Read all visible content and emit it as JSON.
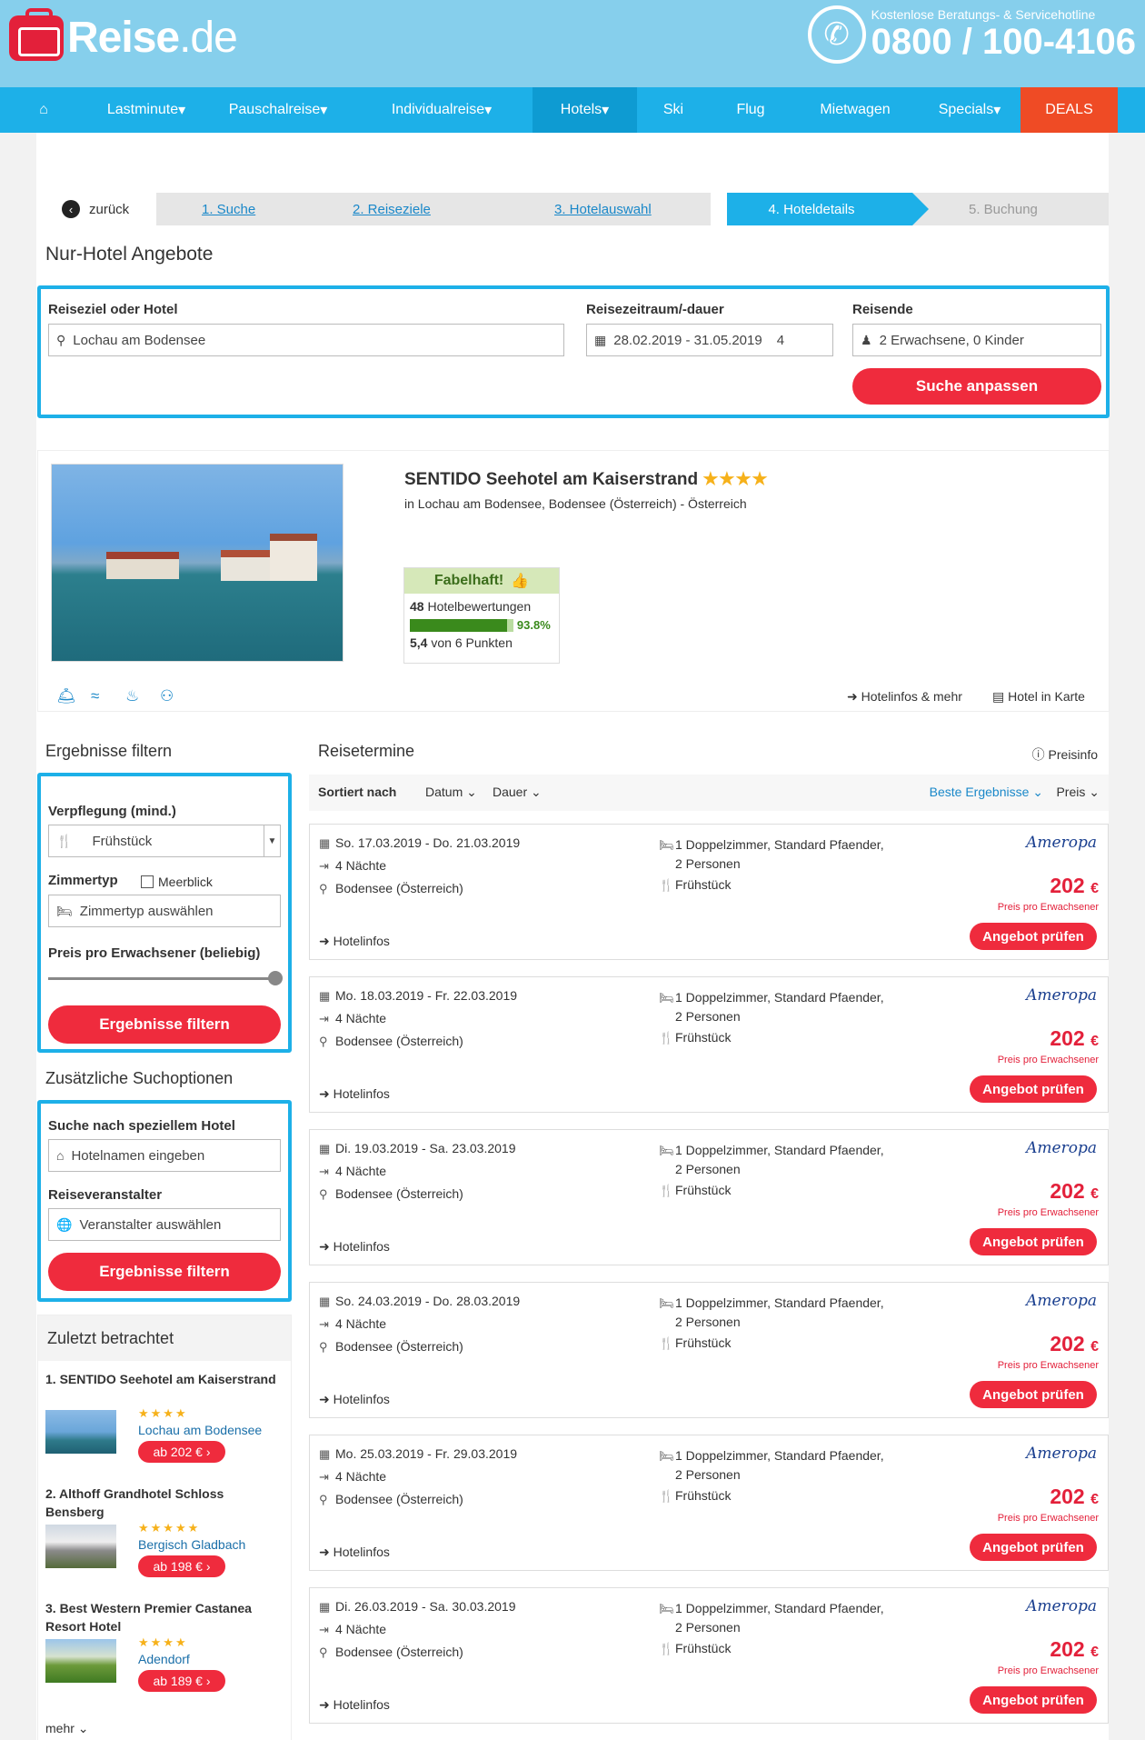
{
  "brand": {
    "logo_main": "Reise",
    "logo_suffix": ".de"
  },
  "hotline": {
    "label": "Kostenlose Beratungs- & Servicehotline",
    "number": "0800 / 100-4106"
  },
  "nav": {
    "home_icon": "home-icon",
    "items": [
      "Lastminute",
      "Pauschalreise",
      "Individualreise",
      "Hotels",
      "Ski",
      "Flug",
      "Mietwagen",
      "Specials",
      "DEALS"
    ],
    "active": "Hotels"
  },
  "steps": {
    "back": "zurück",
    "items": [
      "1. Suche",
      "2. Reiseziele",
      "3. Hotelauswahl",
      "4. Hoteldetails",
      "5. Buchung"
    ],
    "current": 3
  },
  "page_title": "Nur-Hotel Angebote",
  "search": {
    "destination_label": "Reiseziel oder Hotel",
    "destination_value": "Lochau am Bodensee",
    "period_label": "Reisezeitraum/-dauer",
    "period_value": "28.02.2019 - 31.05.2019",
    "duration_value": "4",
    "travelers_label": "Reisende",
    "travelers_value": "2 Erwachsene, 0 Kinder",
    "submit": "Suche anpassen"
  },
  "hotel": {
    "name": "SENTIDO Seehotel am Kaiserstrand",
    "stars": "★★★★",
    "location": "in Lochau am Bodensee, Bodensee (Österreich) - Österreich",
    "rating_label": "Fabelhaft!",
    "reviews_count": "48",
    "reviews_text": "Hotelbewertungen",
    "recommend_pct": "93.8%",
    "recommend_fraction": 0.938,
    "score": "5,4",
    "score_text": "von 6 Punkten",
    "link_info": "Hotelinfos & mehr",
    "link_map": "Hotel in Karte"
  },
  "filter": {
    "title": "Ergebnisse filtern",
    "board_label": "Verpflegung (mind.)",
    "board_value": "Frühstück",
    "room_label": "Zimmertyp",
    "seaview_label": "Meerblick",
    "room_placeholder": "Zimmertyp auswählen",
    "price_label": "Preis pro Erwachsener (beliebig)",
    "slider_value": 1.0,
    "submit": "Ergebnisse filtern"
  },
  "extra": {
    "title": "Zusätzliche Suchoptionen",
    "hotel_label": "Suche nach speziellem Hotel",
    "hotel_placeholder": "Hotelnamen eingeben",
    "operator_label": "Reiseveranstalter",
    "operator_placeholder": "Veranstalter auswählen",
    "submit": "Ergebnisse filtern"
  },
  "recent": {
    "title": "Zuletzt betrachtet",
    "items": [
      {
        "name": "1. SENTIDO Seehotel am Kaiserstrand",
        "stars": "★★★★",
        "city": "Lochau am Bodensee",
        "price": "ab 202 € ›"
      },
      {
        "name": "2. Althoff Grandhotel Schloss Bensberg",
        "stars": "★★★★★",
        "city": "Bergisch Gladbach",
        "price": "ab 198 € ›"
      },
      {
        "name": "3. Best Western Premier Castanea Resort Hotel",
        "stars": "★★★★",
        "city": "Adendorf",
        "price": "ab 189 € ›"
      }
    ],
    "more": "mehr"
  },
  "results": {
    "title": "Reisetermine",
    "price_info": "Preisinfo",
    "sort_label": "Sortiert nach",
    "sort_date": "Datum",
    "sort_duration": "Dauer",
    "sort_best": "Beste Ergebnisse",
    "sort_price": "Preis",
    "items": [
      {
        "dates": "So. 17.03.2019 - Do. 21.03.2019",
        "nights": "4 Nächte",
        "region": "Bodensee (Österreich)",
        "room1": "1 Doppelzimmer, Standard Pfaender,",
        "room2": "2 Personen",
        "board": "Frühstück",
        "operator": "Ameropa",
        "price": "202",
        "currency": "€",
        "per": "Preis pro Erwachsener",
        "info": "Hotelinfos",
        "cta": "Angebot prüfen"
      },
      {
        "dates": "Mo. 18.03.2019 - Fr. 22.03.2019",
        "nights": "4 Nächte",
        "region": "Bodensee (Österreich)",
        "room1": "1 Doppelzimmer, Standard Pfaender,",
        "room2": "2 Personen",
        "board": "Frühstück",
        "operator": "Ameropa",
        "price": "202",
        "currency": "€",
        "per": "Preis pro Erwachsener",
        "info": "Hotelinfos",
        "cta": "Angebot prüfen"
      },
      {
        "dates": "Di. 19.03.2019 - Sa. 23.03.2019",
        "nights": "4 Nächte",
        "region": "Bodensee (Österreich)",
        "room1": "1 Doppelzimmer, Standard Pfaender,",
        "room2": "2 Personen",
        "board": "Frühstück",
        "operator": "Ameropa",
        "price": "202",
        "currency": "€",
        "per": "Preis pro Erwachsener",
        "info": "Hotelinfos",
        "cta": "Angebot prüfen"
      },
      {
        "dates": "So. 24.03.2019 - Do. 28.03.2019",
        "nights": "4 Nächte",
        "region": "Bodensee (Österreich)",
        "room1": "1 Doppelzimmer, Standard Pfaender,",
        "room2": "2 Personen",
        "board": "Frühstück",
        "operator": "Ameropa",
        "price": "202",
        "currency": "€",
        "per": "Preis pro Erwachsener",
        "info": "Hotelinfos",
        "cta": "Angebot prüfen"
      },
      {
        "dates": "Mo. 25.03.2019 - Fr. 29.03.2019",
        "nights": "4 Nächte",
        "region": "Bodensee (Österreich)",
        "room1": "1 Doppelzimmer, Standard Pfaender,",
        "room2": "2 Personen",
        "board": "Frühstück",
        "operator": "Ameropa",
        "price": "202",
        "currency": "€",
        "per": "Preis pro Erwachsener",
        "info": "Hotelinfos",
        "cta": "Angebot prüfen"
      },
      {
        "dates": "Di. 26.03.2019 - Sa. 30.03.2019",
        "nights": "4 Nächte",
        "region": "Bodensee (Österreich)",
        "room1": "1 Doppelzimmer, Standard Pfaender,",
        "room2": "2 Personen",
        "board": "Frühstück",
        "operator": "Ameropa",
        "price": "202",
        "currency": "€",
        "per": "Preis pro Erwachsener",
        "info": "Hotelinfos",
        "cta": "Angebot prüfen"
      }
    ]
  },
  "colors": {
    "accent": "#1db0e8",
    "header": "#86cfec",
    "cta": "#ef2b3d",
    "deals": "#ef4b25"
  }
}
